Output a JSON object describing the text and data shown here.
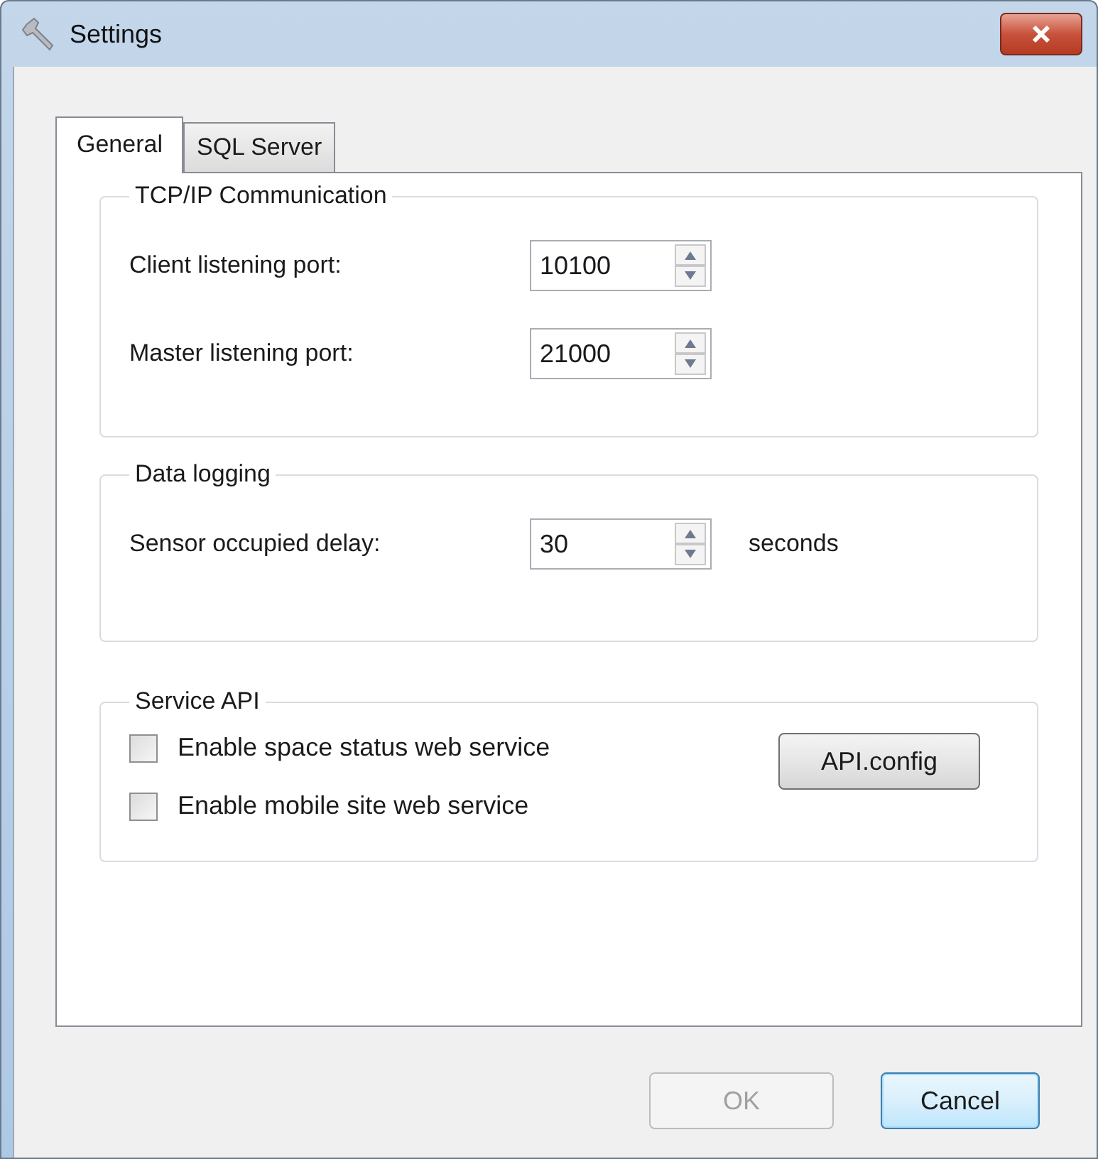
{
  "window": {
    "title": "Settings"
  },
  "tabs": [
    {
      "label": "General",
      "selected": true
    },
    {
      "label": "SQL Server",
      "selected": false
    }
  ],
  "groups": [
    {
      "title": "TCP/IP Communication",
      "kind": "spinners",
      "rows": [
        {
          "label": "Client listening port:",
          "value": "10100"
        },
        {
          "label": "Master listening port:",
          "value": "21000"
        }
      ]
    },
    {
      "title": "Data logging",
      "kind": "spinners",
      "rows": [
        {
          "label": "Sensor occupied delay:",
          "value": "30",
          "unit": "seconds"
        }
      ]
    },
    {
      "title": "Service API",
      "kind": "checkboxes",
      "items": [
        {
          "label": "Enable space status web service",
          "checked": false
        },
        {
          "label": "Enable mobile site web service",
          "checked": false
        }
      ],
      "button": "API.config"
    }
  ],
  "buttons": [
    {
      "label": "OK",
      "disabled": true,
      "focused": false
    },
    {
      "label": "Cancel",
      "disabled": false,
      "focused": true
    }
  ]
}
